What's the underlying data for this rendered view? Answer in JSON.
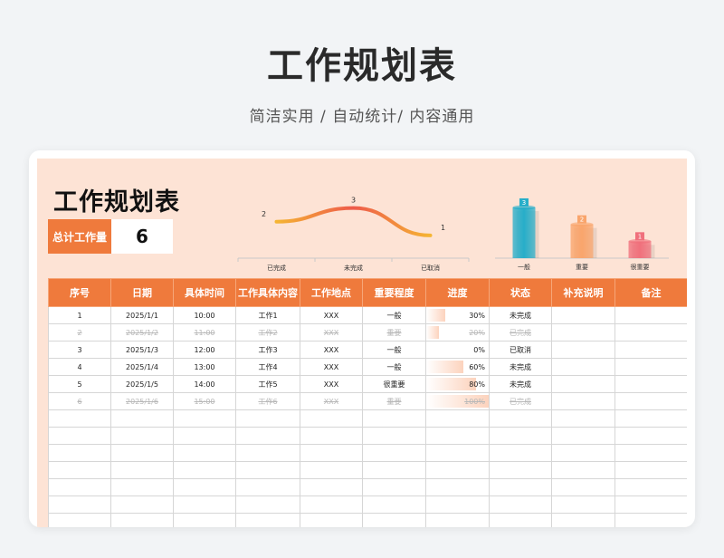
{
  "header": {
    "title": "工作规划表",
    "subtitle": "简洁实用 / 自动统计/ 内容通用"
  },
  "sheet": {
    "title": "工作规划表",
    "kpi": {
      "label": "总计工作量",
      "value": "6"
    }
  },
  "chart_data": [
    {
      "type": "line",
      "categories": [
        "已完成",
        "未完成",
        "已取消"
      ],
      "values": [
        2,
        3,
        1
      ],
      "ylim": [
        0,
        4
      ],
      "grid": false,
      "colors": [
        "#f5b533",
        "#ee5a4a"
      ]
    },
    {
      "type": "bar",
      "categories": [
        "一般",
        "重要",
        "很重要"
      ],
      "values": [
        3,
        2,
        1
      ],
      "ylim": [
        0,
        3
      ],
      "grid": false,
      "colors": [
        "#27aec9",
        "#f9a56c",
        "#f0707c"
      ]
    }
  ],
  "table": {
    "headers": [
      "序号",
      "日期",
      "具体时间",
      "工作具体内容",
      "工作地点",
      "重要程度",
      "进度",
      "状态",
      "补充说明",
      "备注"
    ],
    "rows": [
      {
        "cells": [
          "1",
          "2025/1/1",
          "10:00",
          "工作1",
          "XXX",
          "一般",
          "30%",
          "未完成",
          "",
          ""
        ],
        "progress": 0.3,
        "cancelled": false
      },
      {
        "cells": [
          "2",
          "2025/1/2",
          "11:00",
          "工作2",
          "XXX",
          "重要",
          "20%",
          "已完成",
          "",
          ""
        ],
        "progress": 0.2,
        "cancelled": true
      },
      {
        "cells": [
          "3",
          "2025/1/3",
          "12:00",
          "工作3",
          "XXX",
          "一般",
          "0%",
          "已取消",
          "",
          ""
        ],
        "progress": 0.0,
        "cancelled": false
      },
      {
        "cells": [
          "4",
          "2025/1/4",
          "13:00",
          "工作4",
          "XXX",
          "一般",
          "60%",
          "未完成",
          "",
          ""
        ],
        "progress": 0.6,
        "cancelled": false
      },
      {
        "cells": [
          "5",
          "2025/1/5",
          "14:00",
          "工作5",
          "XXX",
          "很重要",
          "80%",
          "未完成",
          "",
          ""
        ],
        "progress": 0.8,
        "cancelled": false
      },
      {
        "cells": [
          "6",
          "2025/1/6",
          "15:00",
          "工作6",
          "XXX",
          "重要",
          "100%",
          "已完成",
          "",
          ""
        ],
        "progress": 1.0,
        "cancelled": true
      },
      {
        "cells": [
          "",
          "",
          "",
          "",
          "",
          "",
          "",
          "",
          "",
          ""
        ],
        "progress": 0,
        "cancelled": false
      },
      {
        "cells": [
          "",
          "",
          "",
          "",
          "",
          "",
          "",
          "",
          "",
          ""
        ],
        "progress": 0,
        "cancelled": false
      },
      {
        "cells": [
          "",
          "",
          "",
          "",
          "",
          "",
          "",
          "",
          "",
          ""
        ],
        "progress": 0,
        "cancelled": false
      },
      {
        "cells": [
          "",
          "",
          "",
          "",
          "",
          "",
          "",
          "",
          "",
          ""
        ],
        "progress": 0,
        "cancelled": false
      },
      {
        "cells": [
          "",
          "",
          "",
          "",
          "",
          "",
          "",
          "",
          "",
          ""
        ],
        "progress": 0,
        "cancelled": false
      },
      {
        "cells": [
          "",
          "",
          "",
          "",
          "",
          "",
          "",
          "",
          "",
          ""
        ],
        "progress": 0,
        "cancelled": false
      },
      {
        "cells": [
          "",
          "",
          "",
          "",
          "",
          "",
          "",
          "",
          "",
          ""
        ],
        "progress": 0,
        "cancelled": false
      }
    ]
  }
}
